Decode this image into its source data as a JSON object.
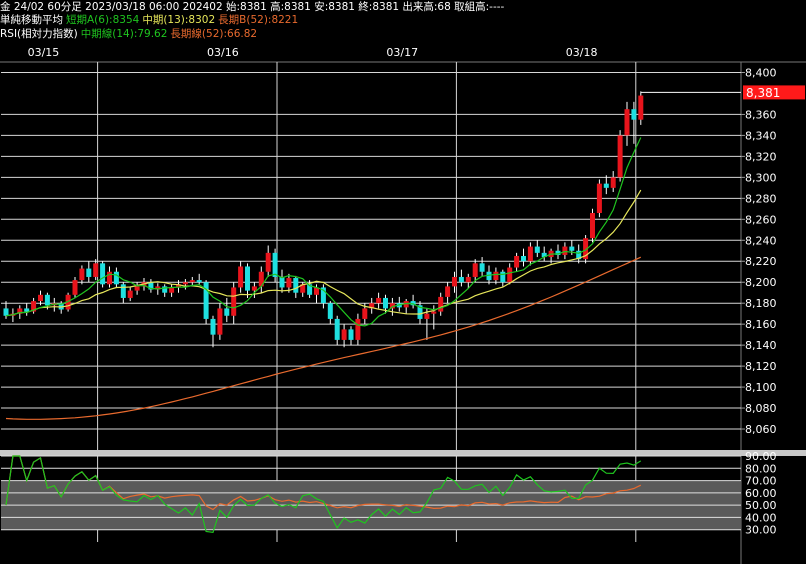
{
  "header": {
    "line1": "金 24/02 60分足 2023/03/18 06:00 202402 始:8381 高:8381 安:8381 終:8381 出来高:68 取組高:----",
    "ma_label": "単純移動平均",
    "ma_short": "短期A(6):8354",
    "ma_mid": "中期(13):8302",
    "ma_long": "長期B(52):8221",
    "rsi_label": "RSI(相対力指数)",
    "rsi_mid": "中期線(14):79.62",
    "rsi_long": "長期線(52):66.82"
  },
  "colors": {
    "up": "#e8141c",
    "down": "#1fe0e0",
    "ma_short": "#1fc41f",
    "ma_mid": "#e6e65a",
    "ma_long": "#e86a2e",
    "price_tag": "#ff1a1a"
  },
  "chart_data": [
    {
      "type": "candlestick",
      "date_labels": [
        "03/15",
        "03/16",
        "03/17",
        "03/18"
      ],
      "date_label_index": [
        14,
        40,
        66,
        92
      ],
      "ylim": [
        8040,
        8410
      ],
      "yticks": [
        8060,
        8080,
        8100,
        8120,
        8140,
        8160,
        8180,
        8200,
        8220,
        8240,
        8260,
        8280,
        8300,
        8320,
        8340,
        8360,
        8400
      ],
      "ytick_labels": [
        "8,060",
        "8,080",
        "8,100",
        "8,120",
        "8,140",
        "8,160",
        "8,180",
        "8,200",
        "8,220",
        "8,240",
        "8,260",
        "8,280",
        "8,300",
        "8,320",
        "8,340",
        "8,360",
        "8,400"
      ],
      "last_price": 8381,
      "last_price_label": "8,381",
      "candles": [
        [
          8175,
          8182,
          8165,
          8168
        ],
        [
          8168,
          8175,
          8162,
          8170
        ],
        [
          8170,
          8178,
          8165,
          8175
        ],
        [
          8175,
          8180,
          8168,
          8172
        ],
        [
          8172,
          8185,
          8170,
          8182
        ],
        [
          8182,
          8192,
          8178,
          8188
        ],
        [
          8188,
          8190,
          8174,
          8178
        ],
        [
          8178,
          8185,
          8172,
          8180
        ],
        [
          8180,
          8182,
          8170,
          8174
        ],
        [
          8174,
          8190,
          8172,
          8188
        ],
        [
          8188,
          8205,
          8185,
          8202
        ],
        [
          8202,
          8216,
          8198,
          8213
        ],
        [
          8213,
          8220,
          8200,
          8205
        ],
        [
          8205,
          8222,
          8202,
          8218
        ],
        [
          8218,
          8220,
          8195,
          8198
        ],
        [
          8198,
          8215,
          8195,
          8210
        ],
        [
          8210,
          8214,
          8195,
          8198
        ],
        [
          8198,
          8200,
          8180,
          8185
        ],
        [
          8185,
          8196,
          8182,
          8192
        ],
        [
          8192,
          8200,
          8188,
          8196
        ],
        [
          8196,
          8204,
          8192,
          8200
        ],
        [
          8200,
          8203,
          8190,
          8193
        ],
        [
          8193,
          8199,
          8188,
          8196
        ],
        [
          8196,
          8198,
          8186,
          8190
        ],
        [
          8190,
          8198,
          8186,
          8195
        ],
        [
          8195,
          8202,
          8190,
          8198
        ],
        [
          8198,
          8203,
          8193,
          8200
        ],
        [
          8200,
          8205,
          8196,
          8202
        ],
        [
          8202,
          8208,
          8197,
          8200
        ],
        [
          8200,
          8202,
          8160,
          8165
        ],
        [
          8165,
          8168,
          8138,
          8150
        ],
        [
          8150,
          8180,
          8145,
          8175
        ],
        [
          8175,
          8185,
          8162,
          8168
        ],
        [
          8168,
          8200,
          8160,
          8195
        ],
        [
          8195,
          8220,
          8190,
          8215
        ],
        [
          8215,
          8218,
          8185,
          8192
        ],
        [
          8192,
          8200,
          8185,
          8196
        ],
        [
          8196,
          8215,
          8190,
          8210
        ],
        [
          8210,
          8235,
          8205,
          8228
        ],
        [
          8228,
          8232,
          8200,
          8205
        ],
        [
          8205,
          8212,
          8190,
          8195
        ],
        [
          8195,
          8208,
          8190,
          8204
        ],
        [
          8204,
          8206,
          8185,
          8190
        ],
        [
          8190,
          8200,
          8186,
          8198
        ],
        [
          8198,
          8202,
          8185,
          8188
        ],
        [
          8188,
          8198,
          8180,
          8195
        ],
        [
          8195,
          8198,
          8175,
          8180
        ],
        [
          8180,
          8182,
          8160,
          8165
        ],
        [
          8165,
          8168,
          8140,
          8145
        ],
        [
          8145,
          8160,
          8138,
          8155
        ],
        [
          8155,
          8158,
          8140,
          8145
        ],
        [
          8145,
          8170,
          8140,
          8165
        ],
        [
          8165,
          8180,
          8160,
          8175
        ],
        [
          8175,
          8185,
          8170,
          8180
        ],
        [
          8180,
          8190,
          8175,
          8185
        ],
        [
          8185,
          8188,
          8170,
          8175
        ],
        [
          8175,
          8185,
          8168,
          8180
        ],
        [
          8180,
          8186,
          8172,
          8176
        ],
        [
          8176,
          8184,
          8170,
          8182
        ],
        [
          8182,
          8188,
          8175,
          8178
        ],
        [
          8178,
          8182,
          8160,
          8165
        ],
        [
          8165,
          8175,
          8145,
          8170
        ],
        [
          8170,
          8178,
          8155,
          8172
        ],
        [
          8172,
          8190,
          8168,
          8186
        ],
        [
          8186,
          8200,
          8180,
          8196
        ],
        [
          8196,
          8210,
          8190,
          8205
        ],
        [
          8205,
          8212,
          8196,
          8200
        ],
        [
          8200,
          8208,
          8194,
          8205
        ],
        [
          8205,
          8222,
          8200,
          8218
        ],
        [
          8218,
          8224,
          8206,
          8210
        ],
        [
          8210,
          8216,
          8198,
          8202
        ],
        [
          8202,
          8214,
          8198,
          8210
        ],
        [
          8210,
          8212,
          8196,
          8200
        ],
        [
          8200,
          8218,
          8198,
          8214
        ],
        [
          8214,
          8228,
          8210,
          8225
        ],
        [
          8225,
          8232,
          8215,
          8220
        ],
        [
          8220,
          8238,
          8216,
          8234
        ],
        [
          8234,
          8240,
          8224,
          8228
        ],
        [
          8228,
          8234,
          8220,
          8224
        ],
        [
          8224,
          8232,
          8218,
          8230
        ],
        [
          8230,
          8236,
          8222,
          8226
        ],
        [
          8226,
          8238,
          8222,
          8234
        ],
        [
          8234,
          8240,
          8226,
          8230
        ],
        [
          8230,
          8236,
          8218,
          8222
        ],
        [
          8222,
          8245,
          8218,
          8242
        ],
        [
          8242,
          8270,
          8238,
          8266
        ],
        [
          8266,
          8298,
          8262,
          8294
        ],
        [
          8294,
          8302,
          8284,
          8290
        ],
        [
          8290,
          8306,
          8286,
          8300
        ],
        [
          8300,
          8345,
          8296,
          8340
        ],
        [
          8340,
          8372,
          8330,
          8365
        ],
        [
          8365,
          8372,
          8332,
          8355
        ],
        [
          8355,
          8382,
          8350,
          8378
        ]
      ],
      "ma_short": [],
      "ma_mid": [],
      "ma_long_start": 8070,
      "ma_long_end": 8221
    },
    {
      "type": "line",
      "title": "RSI",
      "ylim": [
        20,
        90
      ],
      "yticks": [
        30,
        40,
        50,
        60,
        70,
        80,
        90
      ],
      "ytick_labels": [
        "30.00",
        "40.00",
        "50.00",
        "60.00",
        "70.00",
        "80.00",
        "90.00"
      ],
      "rsi14_last": 79.62,
      "rsi52_last": 66.82
    }
  ]
}
